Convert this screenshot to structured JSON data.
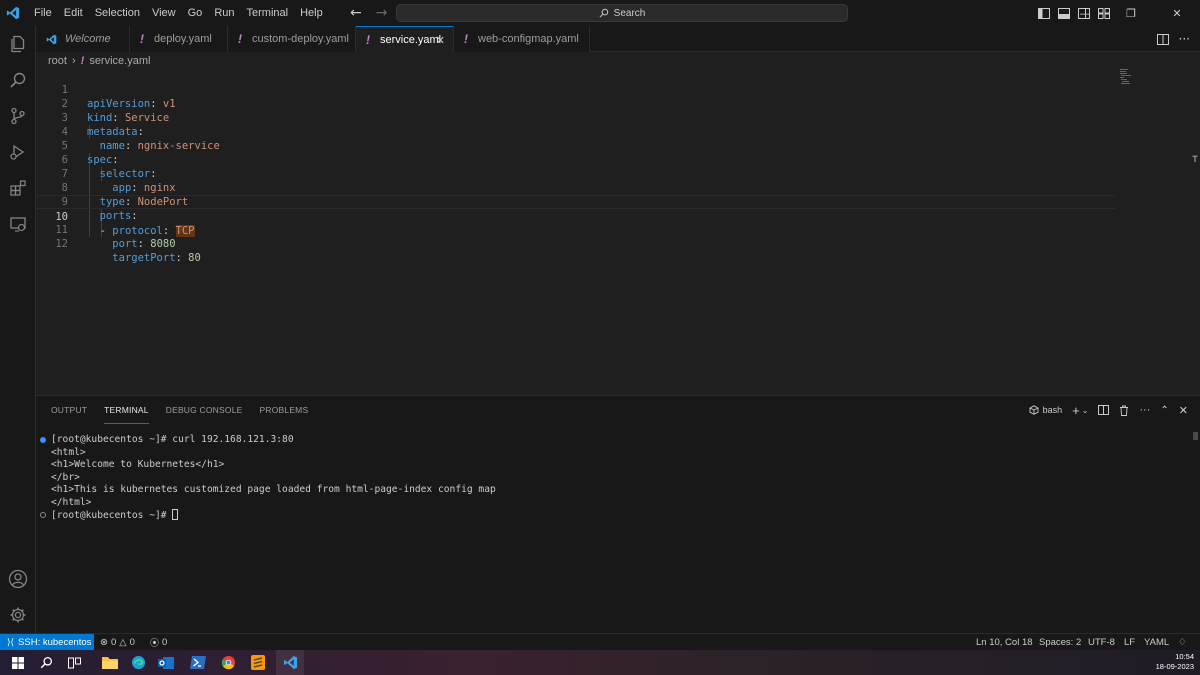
{
  "menu": [
    "File",
    "Edit",
    "Selection",
    "View",
    "Go",
    "Run",
    "Terminal",
    "Help"
  ],
  "search": {
    "label": "Search"
  },
  "tabs": [
    {
      "label": "Welcome"
    },
    {
      "label": "deploy.yaml"
    },
    {
      "label": "custom-deploy.yaml"
    },
    {
      "label": "service.yaml"
    },
    {
      "label": "web-configmap.yaml"
    }
  ],
  "breadcrumb": {
    "root": "root",
    "file": "service.yaml"
  },
  "editor": {
    "lines": [
      {
        "num": "1"
      },
      {
        "num": "2"
      },
      {
        "num": "3"
      },
      {
        "num": "4"
      },
      {
        "num": "5"
      },
      {
        "num": "6"
      },
      {
        "num": "7"
      },
      {
        "num": "8"
      },
      {
        "num": "9"
      },
      {
        "num": "10"
      },
      {
        "num": "11"
      },
      {
        "num": "12"
      }
    ],
    "code": {
      "l1k": "apiVersion",
      "l1v": "v1",
      "l2k": "kind",
      "l2v": "Service",
      "l3k": "metadata",
      "l4k": "name",
      "l4v": "ngnix-service",
      "l5k": "spec",
      "l6k": "selector",
      "l7k": "app",
      "l7v": "nginx",
      "l8k": "type",
      "l8v": "NodePort",
      "l9k": "ports",
      "l10k": "protocol",
      "l10v": "TCP",
      "l11k": "port",
      "l11v": "8080",
      "l12k": "targetPort",
      "l12v": "80"
    }
  },
  "panel": {
    "tabs": [
      "OUTPUT",
      "TERMINAL",
      "DEBUG CONSOLE",
      "PROBLEMS"
    ],
    "active_tab": "TERMINAL",
    "shell": "bash"
  },
  "terminal": {
    "lines": [
      "[root@kubecentos ~]# curl 192.168.121.3:80",
      "<html>",
      "<h1>Welcome to Kubernetes</h1>",
      "</br>",
      "<h1>This is kubernetes customized page loaded from html-page-index config map",
      "</html>",
      "[root@kubecentos ~]# "
    ]
  },
  "statusbar": {
    "remote": "SSH: kubecentos",
    "errors": "0",
    "warnings": "0",
    "ports": "0",
    "position": "Ln 10, Col 18",
    "spaces": "Spaces: 2",
    "encoding": "UTF-8",
    "eol": "LF",
    "language": "YAML"
  },
  "taskbar": {
    "time": "10:54",
    "date": "18-09-2023"
  },
  "colors": {
    "accent": "#0078d4",
    "yaml_key": "#569cd6",
    "yaml_string": "#ce9178",
    "yaml_number": "#b5cea8"
  }
}
